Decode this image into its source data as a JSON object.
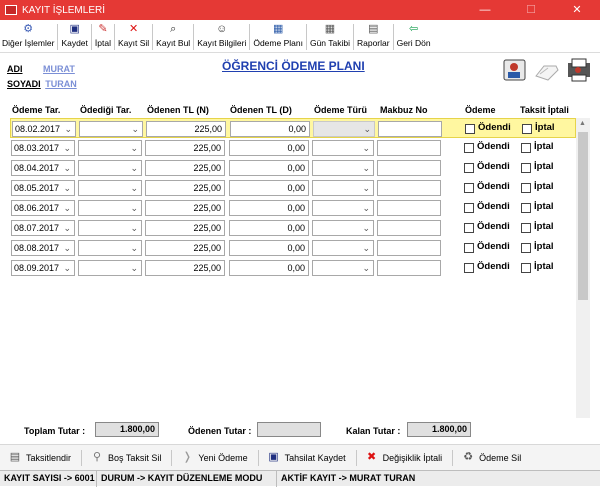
{
  "window": {
    "title": "KAYIT İŞLEMLERİ",
    "minimize": "—",
    "maximize": "☐",
    "close": "✕"
  },
  "toolbar": [
    {
      "label": "Diğer İşlemler",
      "icon": "tools-icon",
      "glyph": "⚙",
      "color": "#3a5bb5"
    },
    {
      "label": "Kaydet",
      "icon": "save-icon",
      "glyph": "▣",
      "color": "#1f2f80"
    },
    {
      "label": "İptal",
      "icon": "cancel-record-icon",
      "glyph": "✎",
      "color": "#c33"
    },
    {
      "label": "Kayıt Sil",
      "icon": "delete-icon",
      "glyph": "✕",
      "color": "#d11"
    },
    {
      "label": "Kayıt Bul",
      "icon": "find-icon",
      "glyph": "⌕",
      "color": "#333"
    },
    {
      "label": "Kayıt Bilgileri",
      "icon": "person-info-icon",
      "glyph": "☺",
      "color": "#333"
    },
    {
      "label": "Ödeme Planı",
      "icon": "calendar-grid-icon",
      "glyph": "▦",
      "color": "#2b5aa8"
    },
    {
      "label": "Gün Takibi",
      "icon": "calendar-icon",
      "glyph": "▦",
      "color": "#555"
    },
    {
      "label": "Raporlar",
      "icon": "report-icon",
      "glyph": "▤",
      "color": "#555"
    },
    {
      "label": "Geri Dön",
      "icon": "back-arrow-icon",
      "glyph": "⇦",
      "color": "#18a050"
    }
  ],
  "student": {
    "name_label": "ADI",
    "name": "MURAT",
    "surname_label": "SOYADI",
    "surname": "TURAN"
  },
  "page_title": "ÖĞRENCİ ÖDEME PLANI",
  "columns": {
    "odeme_tar": "Ödeme Tar.",
    "odedigi_tar": "Ödediği Tar.",
    "odenen_tl_n": "Ödenen TL (N)",
    "odenen_tl_d": "Ödenen TL (D)",
    "odeme_turu": "Ödeme Türü",
    "makbuz_no": "Makbuz No",
    "odeme": "Ödeme",
    "taksit_iptali": "Taksit İptali"
  },
  "rows": [
    {
      "odeme_tar": "08.02.2017",
      "odenen_n": "225,00",
      "odenen_d": "0,00",
      "odendi": "Ödendi",
      "iptal": "İptal",
      "selected": true
    },
    {
      "odeme_tar": "08.03.2017",
      "odenen_n": "225,00",
      "odenen_d": "0,00",
      "odendi": "Ödendi",
      "iptal": "İptal"
    },
    {
      "odeme_tar": "08.04.2017",
      "odenen_n": "225,00",
      "odenen_d": "0,00",
      "odendi": "Ödendi",
      "iptal": "İptal"
    },
    {
      "odeme_tar": "08.05.2017",
      "odenen_n": "225,00",
      "odenen_d": "0,00",
      "odendi": "Ödendi",
      "iptal": "İptal"
    },
    {
      "odeme_tar": "08.06.2017",
      "odenen_n": "225,00",
      "odenen_d": "0,00",
      "odendi": "Ödendi",
      "iptal": "İptal"
    },
    {
      "odeme_tar": "08.07.2017",
      "odenen_n": "225,00",
      "odenen_d": "0,00",
      "odendi": "Ödendi",
      "iptal": "İptal"
    },
    {
      "odeme_tar": "08.08.2017",
      "odenen_n": "225,00",
      "odenen_d": "0,00",
      "odendi": "Ödendi",
      "iptal": "İptal"
    },
    {
      "odeme_tar": "08.09.2017",
      "odenen_n": "225,00",
      "odenen_d": "0,00",
      "odendi": "Ödendi",
      "iptal": "İptal"
    }
  ],
  "totals": {
    "toplam_label": "Toplam Tutar :",
    "toplam_value": "1.800,00",
    "odenen_label": "Ödenen Tutar :",
    "odenen_value": "",
    "kalan_label": "Kalan Tutar :",
    "kalan_value": "1.800,00"
  },
  "bottom_buttons": [
    {
      "label": "Taksitlendir",
      "icon": "installment-icon",
      "glyph": "▤",
      "color": "#555"
    },
    {
      "label": "Boş Taksit Sil",
      "icon": "empty-delete-icon",
      "glyph": "⚲",
      "color": "#777"
    },
    {
      "label": "Yeni Ödeme",
      "icon": "new-payment-icon",
      "glyph": "❭",
      "color": "#999"
    },
    {
      "label": "Tahsilat Kaydet",
      "icon": "save-collection-icon",
      "glyph": "▣",
      "color": "#1f2f80"
    },
    {
      "label": "Değişiklik İptali",
      "icon": "cancel-changes-icon",
      "glyph": "✖",
      "color": "#d11"
    },
    {
      "label": "Ödeme Sil",
      "icon": "payment-delete-icon",
      "glyph": "♻",
      "color": "#555"
    }
  ],
  "status": {
    "kayit_sayisi": "KAYIT SAYISI -> 6001",
    "durum": "DURUM -> KAYIT DÜZENLEME MODU",
    "aktif_kayit": "AKTİF KAYIT -> MURAT TURAN"
  }
}
